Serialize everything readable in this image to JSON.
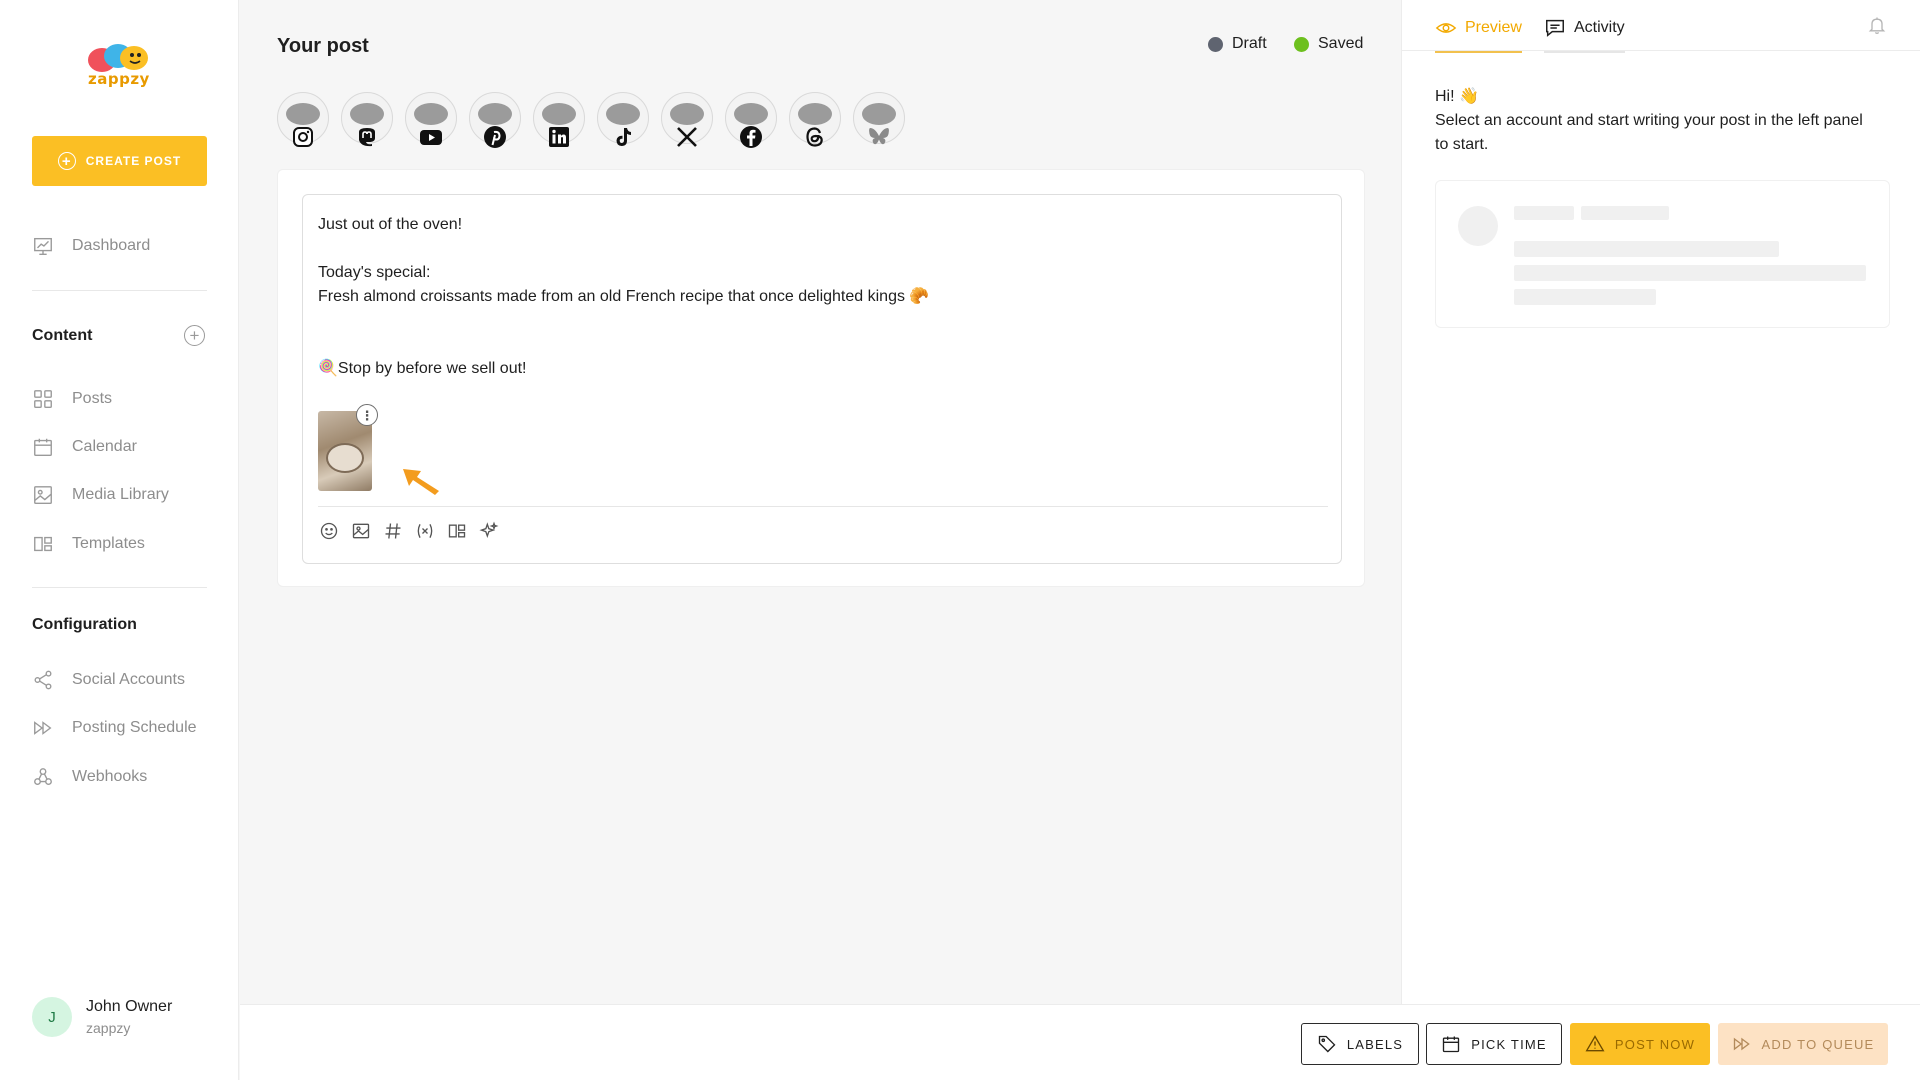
{
  "brand": {
    "name": "zappzy",
    "accent": "#fbbf24"
  },
  "sidebar": {
    "create_label": "CREATE POST",
    "dashboard": "Dashboard",
    "content_title": "Content",
    "content_items": [
      {
        "label": "Posts",
        "icon": "grid-icon"
      },
      {
        "label": "Calendar",
        "icon": "calendar-icon"
      },
      {
        "label": "Media Library",
        "icon": "image-icon"
      },
      {
        "label": "Templates",
        "icon": "templates-icon"
      }
    ],
    "config_title": "Configuration",
    "config_items": [
      {
        "label": "Social Accounts",
        "icon": "share-icon"
      },
      {
        "label": "Posting Schedule",
        "icon": "fast-forward-icon"
      },
      {
        "label": "Webhooks",
        "icon": "webhook-icon"
      }
    ],
    "user": {
      "initial": "J",
      "name": "John Owner",
      "org": "zappzy"
    }
  },
  "main": {
    "title": "Your post",
    "status_draft": "Draft",
    "status_saved": "Saved",
    "accounts": [
      "instagram",
      "mastodon",
      "youtube",
      "pinterest",
      "linkedin",
      "tiktok",
      "x",
      "facebook",
      "threads",
      "bluesky"
    ],
    "post_lines": {
      "line1": "Just out of the oven!",
      "line2": "Today's special:",
      "line3": "Fresh almond croissants made from an old French recipe that once delighted kings 🥐",
      "line4": "🍭Stop by before we sell out!"
    }
  },
  "right": {
    "tab_preview": "Preview",
    "tab_activity": "Activity",
    "hi": "Hi! 👋",
    "hint": "Select an account and start writing your post in the left panel to start."
  },
  "bottom": {
    "labels": "LABELS",
    "pick_time": "PICK TIME",
    "post_now": "POST NOW",
    "add_queue": "ADD TO QUEUE"
  }
}
